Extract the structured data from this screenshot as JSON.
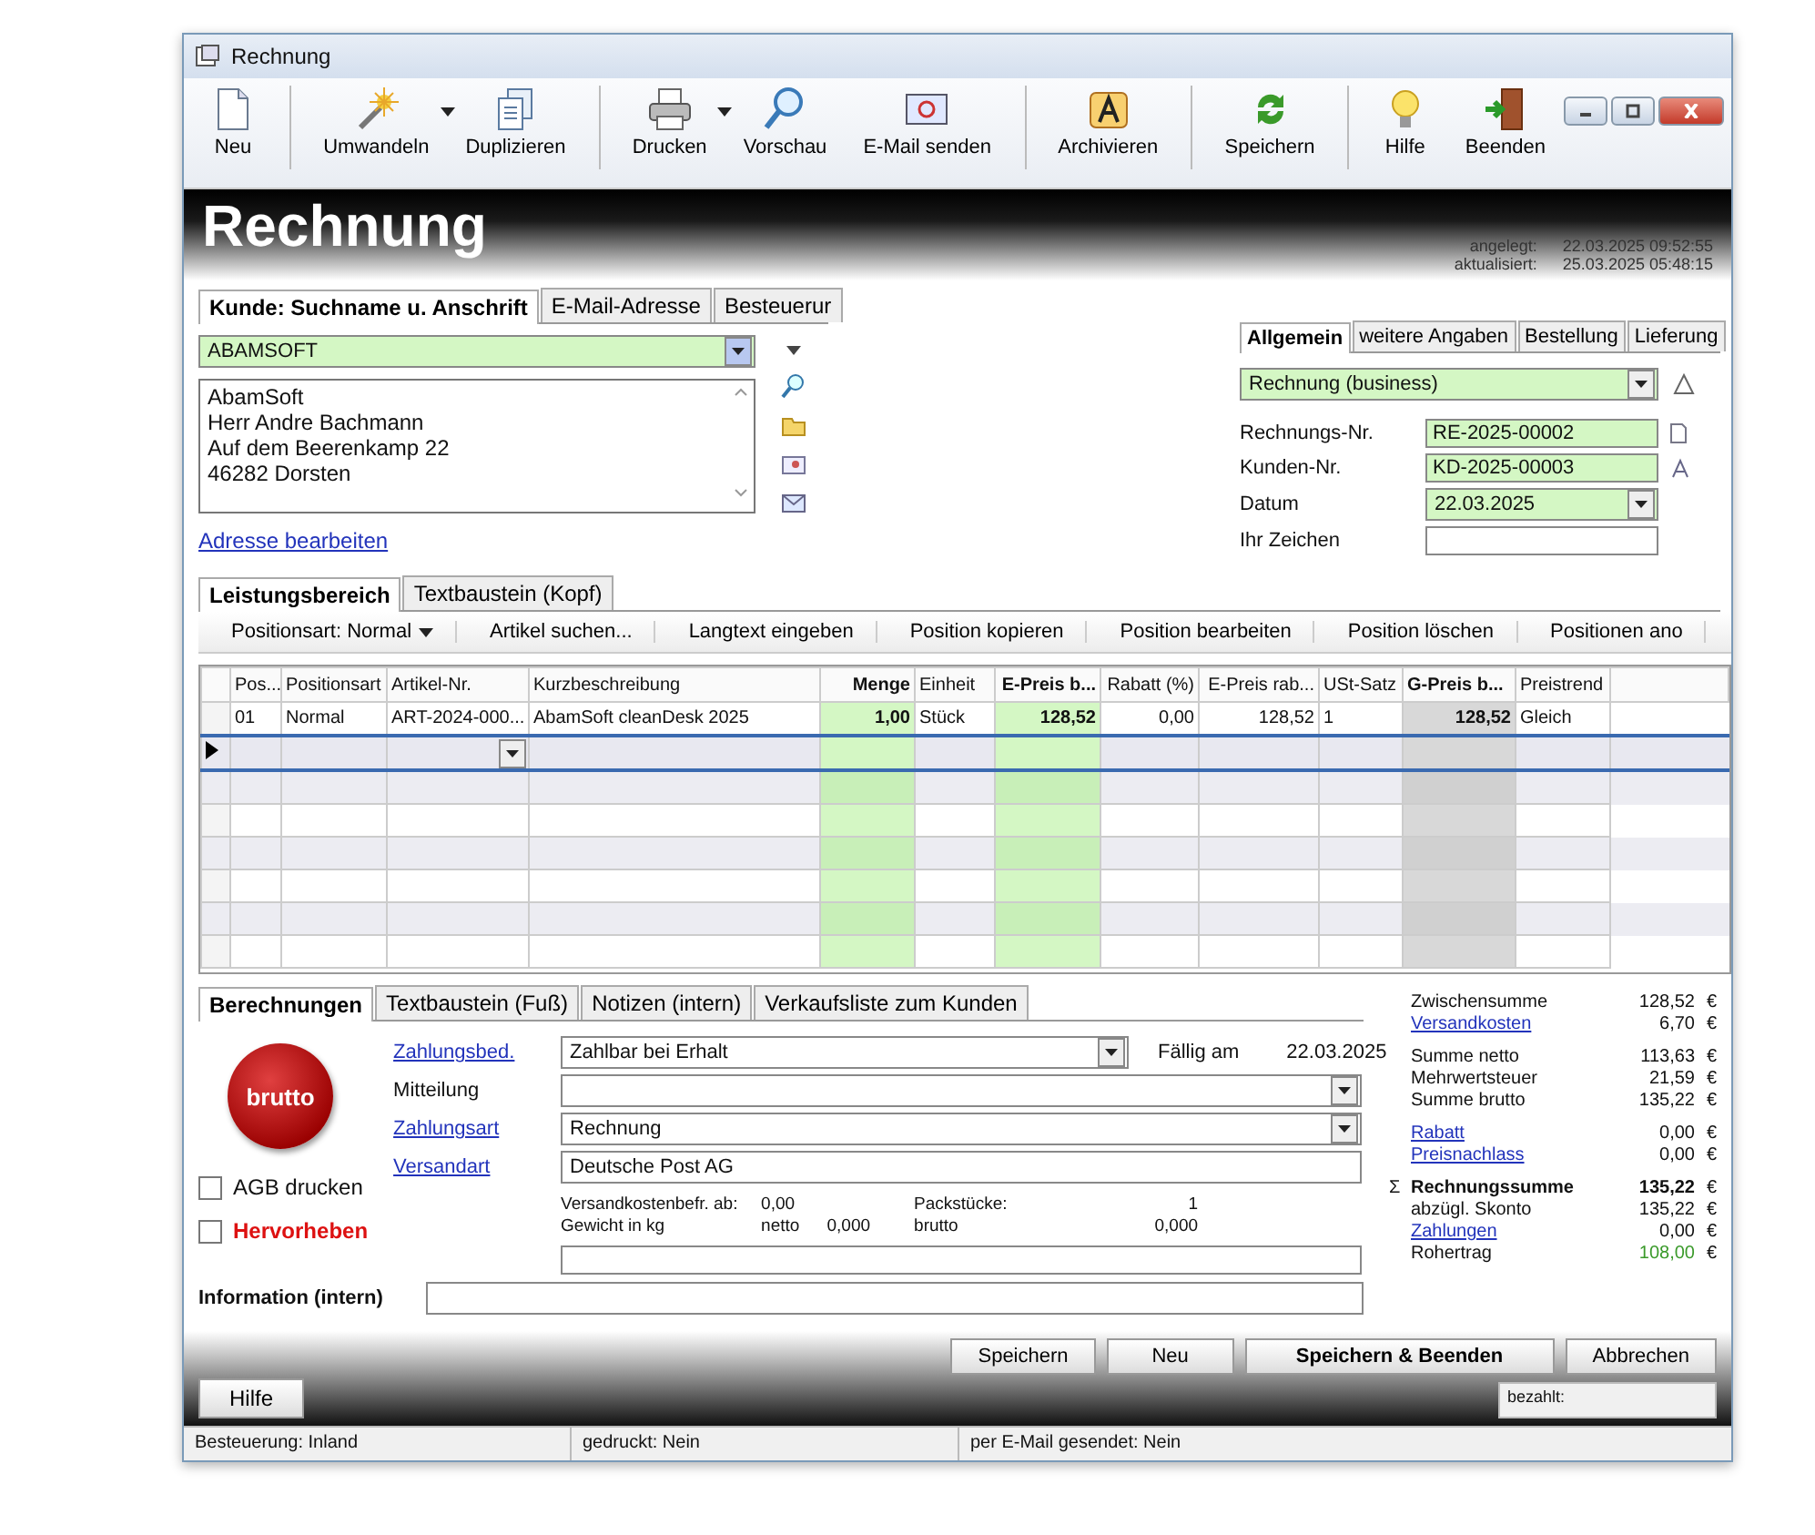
{
  "window": {
    "title": "Rechnung"
  },
  "toolbar": [
    [
      {
        "label": "Neu",
        "dropdown": false
      }
    ],
    [
      {
        "label": "Umwandeln",
        "dropdown": true
      },
      {
        "label": "Duplizieren",
        "dropdown": false
      }
    ],
    [
      {
        "label": "Drucken",
        "dropdown": true
      },
      {
        "label": "Vorschau",
        "dropdown": false
      },
      {
        "label": "E-Mail senden",
        "dropdown": false
      }
    ],
    [
      {
        "label": "Archivieren",
        "dropdown": false
      }
    ],
    [
      {
        "label": "Speichern",
        "dropdown": false
      }
    ],
    [
      {
        "label": "Hilfe",
        "dropdown": false
      },
      {
        "label": "Beenden",
        "dropdown": false
      }
    ]
  ],
  "header": {
    "title": "Rechnung",
    "created_label": "angelegt:",
    "created": "22.03.2025 09:52:55",
    "updated_label": "aktualisiert:",
    "updated": "25.03.2025 05:48:15"
  },
  "customer_tabs": [
    {
      "label": "Kunde: Suchname u. Anschrift",
      "selected": true
    },
    {
      "label": "E-Mail-Adresse",
      "selected": false
    },
    {
      "label": "Besteuerur",
      "selected": false
    }
  ],
  "customer": {
    "search": "ABAMSOFT",
    "address": [
      "AbamSoft",
      "Herr Andre Bachmann",
      "Auf dem Beerenkamp 22",
      "46282 Dorsten"
    ],
    "edit_link": "Adresse bearbeiten"
  },
  "document_tabs": [
    {
      "label": "Allgemein",
      "selected": true
    },
    {
      "label": "weitere Angaben",
      "selected": false
    },
    {
      "label": "Bestellung",
      "selected": false
    },
    {
      "label": "Lieferung",
      "selected": false
    }
  ],
  "document": {
    "type": "Rechnung (business)",
    "fields": [
      {
        "label": "Rechnungs-Nr.",
        "value": "RE-2025-00002",
        "kind": "text"
      },
      {
        "label": "Kunden-Nr.",
        "value": "KD-2025-00003",
        "kind": "text"
      },
      {
        "label": "Datum",
        "value": "22.03.2025",
        "kind": "date"
      },
      {
        "label": "Ihr Zeichen",
        "kind": "blank"
      }
    ]
  },
  "position_tabs": [
    {
      "label": "Leistungsbereich",
      "selected": true
    },
    {
      "label": "Textbaustein (Kopf)",
      "selected": false
    }
  ],
  "position_toolbar": [
    {
      "label": "Positionsart: Normal",
      "dropdown": true
    },
    {
      "label": "Artikel suchen...",
      "dropdown": false
    },
    {
      "label": "Langtext eingeben",
      "dropdown": false
    },
    {
      "label": "Position kopieren",
      "dropdown": false
    },
    {
      "label": "Position bearbeiten",
      "dropdown": false
    },
    {
      "label": "Position löschen",
      "dropdown": false
    },
    {
      "label": "Positionen ano",
      "dropdown": false
    }
  ],
  "table": {
    "columns": [
      {
        "label": "Pos...",
        "kind": "text"
      },
      {
        "label": "Positionsart",
        "kind": "text"
      },
      {
        "label": "Artikel-Nr.",
        "kind": "text"
      },
      {
        "label": "Kurzbeschreibung",
        "kind": "text"
      },
      {
        "label": "Menge",
        "kind": "entry"
      },
      {
        "label": "Einheit",
        "kind": "text"
      },
      {
        "label": "E-Preis b...",
        "kind": "entry"
      },
      {
        "label": "Rabatt (%)",
        "kind": "number"
      },
      {
        "label": "E-Preis rab...",
        "kind": "number"
      },
      {
        "label": "USt-Satz",
        "kind": "text"
      },
      {
        "label": "G-Preis b...",
        "kind": "total"
      },
      {
        "label": "Preistrend",
        "kind": "text"
      }
    ],
    "rows": [
      {
        "current": false,
        "cells": [
          "01",
          "Normal",
          "ART-2024-000...",
          "AbamSoft cleanDesk 2025",
          "1,00",
          "Stück",
          "128,52",
          "0,00",
          "128,52",
          "1",
          "128,52",
          "Gleich"
        ]
      },
      {
        "current": true
      }
    ]
  },
  "footer_tabs": [
    {
      "label": "Berechnungen",
      "selected": true
    },
    {
      "label": "Textbaustein (Fuß)",
      "selected": false
    },
    {
      "label": "Notizen (intern)",
      "selected": false
    },
    {
      "label": "Verkaufsliste zum Kunden",
      "selected": false
    }
  ],
  "calculation": {
    "badge": "brutto",
    "due_label": "Fällig am",
    "due": "22.03.2025",
    "fields": [
      {
        "label": "Zahlungsbed.",
        "kind": "link",
        "value": "Zahlbar bei Erhalt",
        "dropdown": true
      },
      {
        "label": "Mitteilung",
        "kind": "text",
        "dropdown": true
      },
      {
        "label": "Zahlungsart",
        "kind": "link",
        "value": "Rechnung",
        "dropdown": true
      },
      {
        "label": "Versandart",
        "kind": "link",
        "value": "Deutsche Post AG",
        "dropdown": false
      }
    ],
    "shipping": {
      "free_label": "Versandkostenbefr. ab:",
      "free": "0,00",
      "packages_label": "Packstücke:",
      "packages": "1",
      "weight_label": "Gewicht in kg",
      "net_label": "netto",
      "net": "0,000",
      "gross_label": "brutto",
      "gross": "0,000"
    },
    "options": [
      {
        "label": "AGB drucken",
        "checked": false,
        "kind": "normal"
      },
      {
        "label": "Hervorheben",
        "checked": false,
        "kind": "emphasis"
      }
    ],
    "info_label": "Information (intern)"
  },
  "totals": [
    [
      {
        "label": "Zwischensumme",
        "value": "128,52",
        "currency": "€",
        "kind": "text"
      },
      {
        "label": "Versandkosten",
        "value": "6,70",
        "currency": "€",
        "kind": "link"
      }
    ],
    [
      {
        "label": "Summe netto",
        "value": "113,63",
        "currency": "€",
        "kind": "text"
      },
      {
        "label": "Mehrwertsteuer",
        "value": "21,59",
        "currency": "€",
        "kind": "text"
      },
      {
        "label": "Summe brutto",
        "value": "135,22",
        "currency": "€",
        "kind": "text"
      }
    ],
    [
      {
        "label": "Rabatt",
        "value": "0,00",
        "currency": "€",
        "kind": "link"
      },
      {
        "label": "Preisnachlass",
        "value": "0,00",
        "currency": "€",
        "kind": "link"
      }
    ],
    [
      {
        "label": "Rechnungssumme",
        "value": "135,22",
        "currency": "€",
        "kind": "total",
        "marker": "Σ"
      },
      {
        "label": "abzügl. Skonto",
        "value": "135,22",
        "currency": "€",
        "kind": "text"
      },
      {
        "label": "Zahlungen",
        "value": "0,00",
        "currency": "€",
        "kind": "link"
      },
      {
        "label": "Rohertrag",
        "value": "108,00",
        "currency": "€",
        "kind": "profit"
      }
    ]
  ],
  "actions": [
    {
      "label": "Speichern",
      "kind": "normal"
    },
    {
      "label": "Neu",
      "kind": "normal"
    },
    {
      "label": "Speichern & Beenden",
      "kind": "primary"
    },
    {
      "label": "Abbrechen",
      "kind": "normal"
    }
  ],
  "paid_label": "bezahlt:",
  "help_button": "Hilfe",
  "status_bar": [
    "Besteuerung: Inland",
    "gedruckt: Nein",
    "per E-Mail gesendet: Nein"
  ]
}
